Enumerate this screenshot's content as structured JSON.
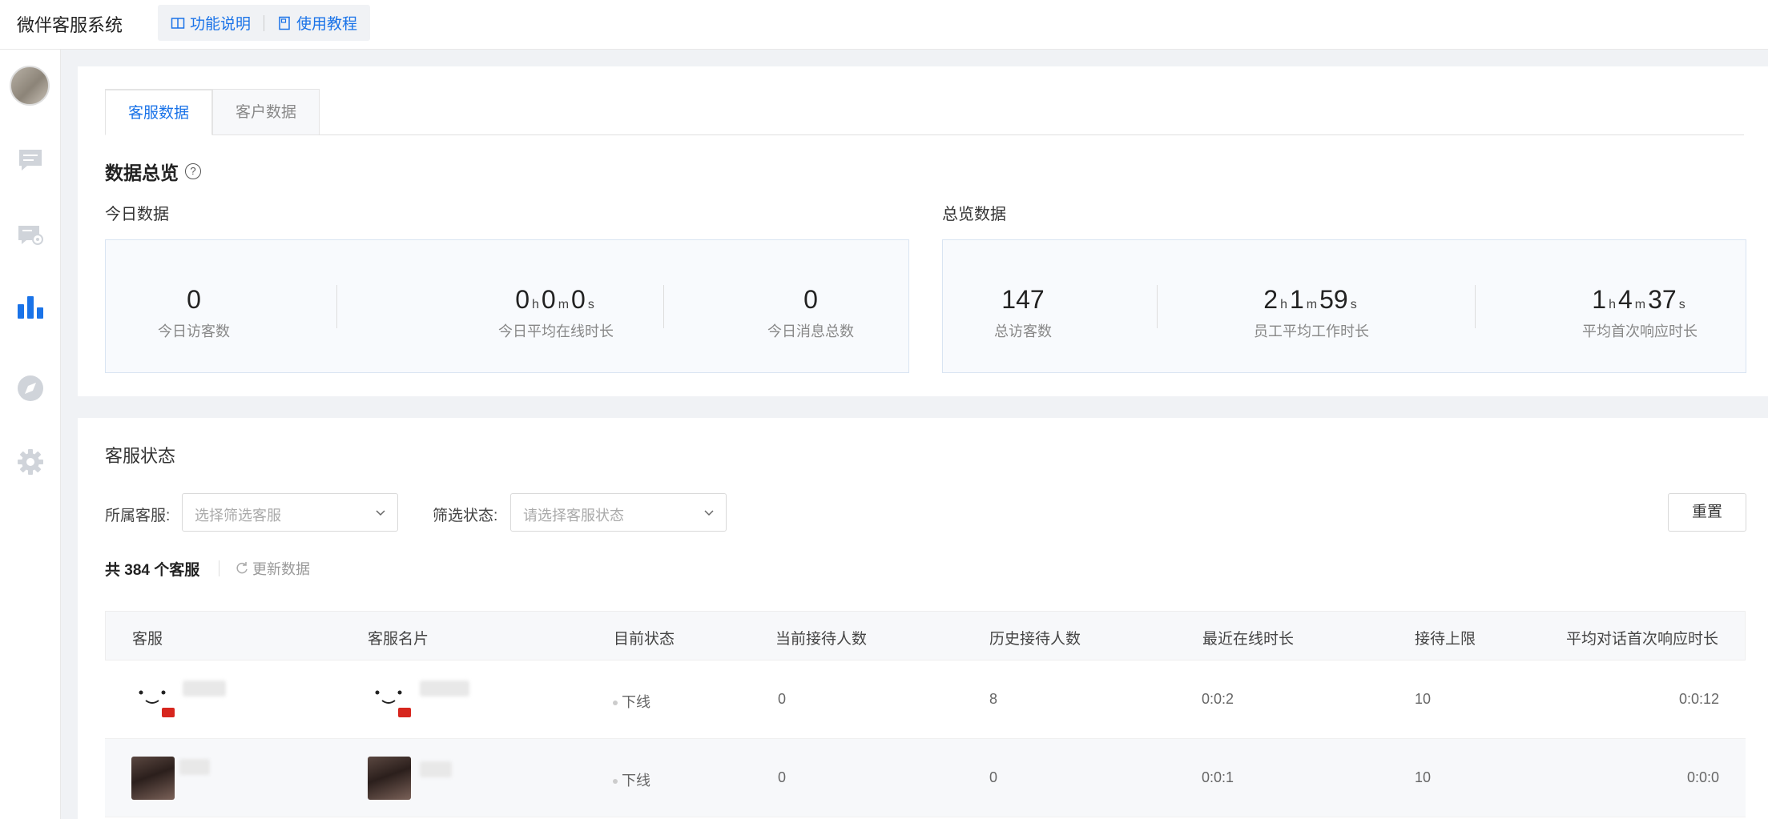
{
  "header": {
    "app_title": "微伴客服系统",
    "links": [
      {
        "label": "功能说明",
        "icon": "book-icon"
      },
      {
        "label": "使用教程",
        "icon": "tutorial-icon"
      }
    ]
  },
  "sidebar": {
    "items": [
      {
        "name": "chat",
        "icon": "chat-icon"
      },
      {
        "name": "message-settings",
        "icon": "message-gear-icon"
      },
      {
        "name": "statistics",
        "icon": "bar-chart-icon",
        "active": true
      },
      {
        "name": "explore",
        "icon": "compass-icon"
      },
      {
        "name": "settings",
        "icon": "gear-icon"
      }
    ]
  },
  "tabs": [
    {
      "label": "客服数据",
      "active": true
    },
    {
      "label": "客户数据",
      "active": false
    }
  ],
  "overview": {
    "title": "数据总览",
    "today_label": "今日数据",
    "total_label": "总览数据",
    "today": [
      {
        "value": "0",
        "label": "今日访客数"
      },
      {
        "h": "0",
        "m": "0",
        "s": "0",
        "label": "今日平均在线时长"
      },
      {
        "value": "0",
        "label": "今日消息总数"
      }
    ],
    "total": [
      {
        "value": "147",
        "label": "总访客数"
      },
      {
        "h": "2",
        "m": "1",
        "s": "59",
        "label": "员工平均工作时长"
      },
      {
        "h": "1",
        "m": "4",
        "s": "37",
        "label": "平均首次响应时长"
      }
    ],
    "units": {
      "h": "h",
      "m": "m",
      "s": "s"
    }
  },
  "status": {
    "title": "客服状态",
    "filter_agent_label": "所属客服:",
    "filter_agent_placeholder": "选择筛选客服",
    "filter_status_label": "筛选状态:",
    "filter_status_placeholder": "请选择客服状态",
    "reset_label": "重置",
    "count_text": "共 384 个客服",
    "refresh_label": "更新数据"
  },
  "table": {
    "columns": [
      "客服",
      "客服名片",
      "目前状态",
      "当前接待人数",
      "历史接待人数",
      "最近在线时长",
      "接待上限",
      "平均对话首次响应时长"
    ],
    "rows": [
      {
        "status": "下线",
        "current": "0",
        "history": "8",
        "recent_online": "0:0:2",
        "limit": "10",
        "avg_response": "0:0:12"
      },
      {
        "status": "下线",
        "current": "0",
        "history": "0",
        "recent_online": "0:0:1",
        "limit": "10",
        "avg_response": "0:0:0"
      }
    ]
  },
  "colors": {
    "accent": "#1a73e8",
    "stat_bg": "#f8fafd",
    "stat_border": "#d9e4f2"
  }
}
